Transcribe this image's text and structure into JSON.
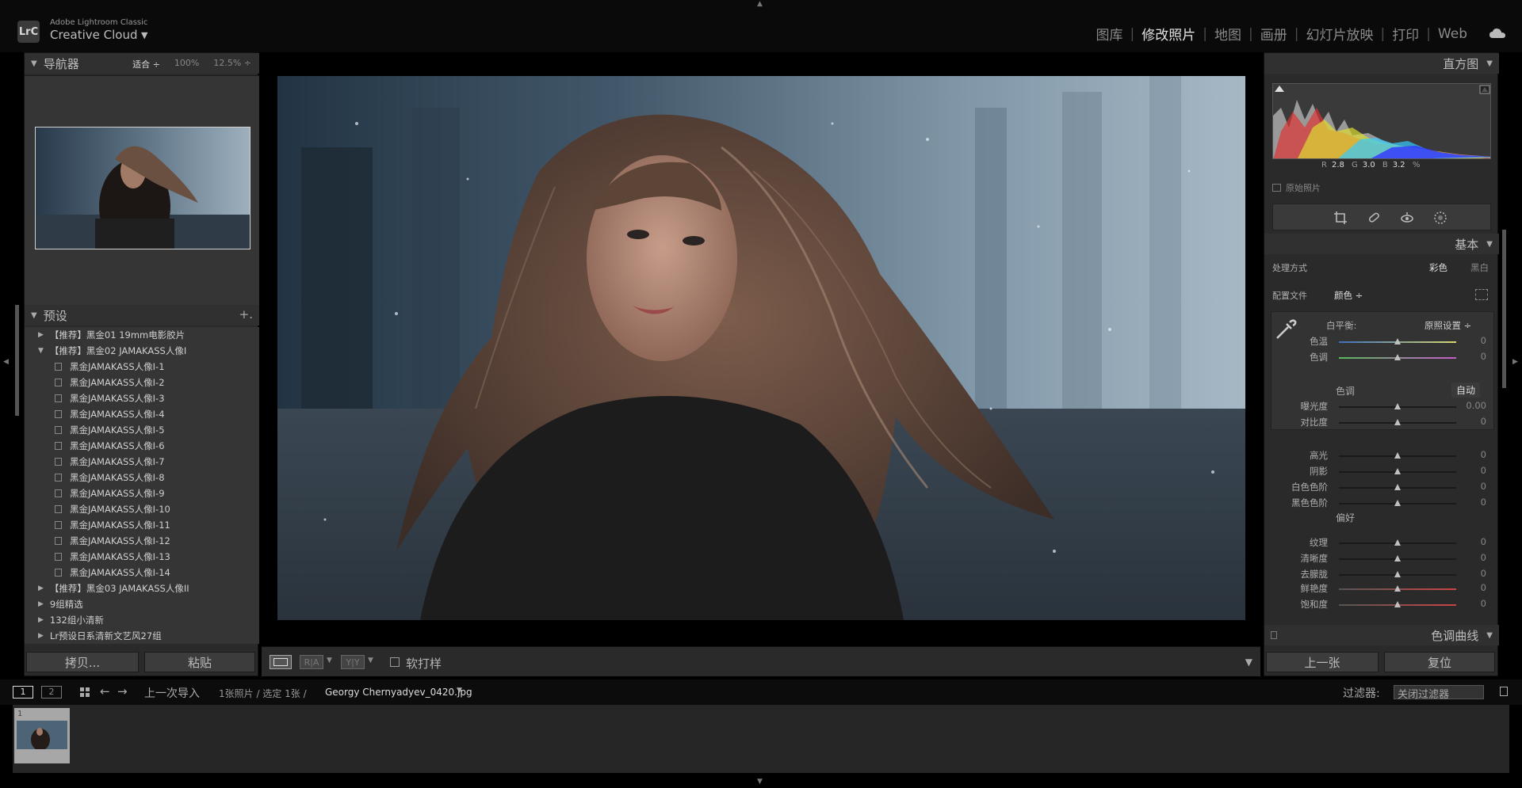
{
  "app": {
    "brand_small": "Adobe Lightroom Classic",
    "brand_big": "Creative Cloud",
    "logo": "LrC"
  },
  "modules": [
    {
      "label": "图库",
      "active": false
    },
    {
      "label": "修改照片",
      "active": true
    },
    {
      "label": "地图",
      "active": false
    },
    {
      "label": "画册",
      "active": false
    },
    {
      "label": "幻灯片放映",
      "active": false
    },
    {
      "label": "打印",
      "active": false
    },
    {
      "label": "Web",
      "active": false
    }
  ],
  "navigator": {
    "title": "导航器",
    "fit": "适合 ÷",
    "zoom1": "100%",
    "zoom2": "12.5% ÷"
  },
  "presets": {
    "title": "预设",
    "plus": "+.",
    "rows": [
      {
        "type": "folder",
        "open": false,
        "label": "【推荐】黑金01 19mm电影胶片"
      },
      {
        "type": "folder",
        "open": true,
        "label": "【推荐】黑金02 JAMAKASS人像I"
      },
      {
        "type": "item",
        "label": "黑金JAMAKASS人像I-1"
      },
      {
        "type": "item",
        "label": "黑金JAMAKASS人像I-2"
      },
      {
        "type": "item",
        "label": "黑金JAMAKASS人像I-3"
      },
      {
        "type": "item",
        "label": "黑金JAMAKASS人像I-4"
      },
      {
        "type": "item",
        "label": "黑金JAMAKASS人像I-5"
      },
      {
        "type": "item",
        "label": "黑金JAMAKASS人像I-6"
      },
      {
        "type": "item",
        "label": "黑金JAMAKASS人像I-7"
      },
      {
        "type": "item",
        "label": "黑金JAMAKASS人像I-8"
      },
      {
        "type": "item",
        "label": "黑金JAMAKASS人像I-9"
      },
      {
        "type": "item",
        "label": "黑金JAMAKASS人像I-10"
      },
      {
        "type": "item",
        "label": "黑金JAMAKASS人像I-11"
      },
      {
        "type": "item",
        "label": "黑金JAMAKASS人像I-12"
      },
      {
        "type": "item",
        "label": "黑金JAMAKASS人像I-13"
      },
      {
        "type": "item",
        "label": "黑金JAMAKASS人像I-14"
      },
      {
        "type": "folder",
        "open": false,
        "label": "【推荐】黑金03 JAMAKASS人像II"
      },
      {
        "type": "folder",
        "open": false,
        "label": "9组精选"
      },
      {
        "type": "folder",
        "open": false,
        "label": "132组小清新"
      },
      {
        "type": "folder",
        "open": false,
        "label": "Lr预设日系清新文艺风27组"
      }
    ]
  },
  "left_buttons": {
    "copy": "拷贝...",
    "paste": "粘贴"
  },
  "toolbar": {
    "softproof": "软打样",
    "ra": "R|A",
    "yy": "Y|Y"
  },
  "histogram": {
    "title": "直方图",
    "r_label": "R",
    "r_value": "2.8",
    "g_label": "G",
    "g_value": "3.0",
    "b_label": "B",
    "b_value": "3.2",
    "percent": "%",
    "original": "原始照片"
  },
  "basic": {
    "title": "基本",
    "treatment_label": "处理方式",
    "treatment_color": "彩色",
    "treatment_bw": "黑白",
    "profile_label": "配置文件",
    "profile_value": "颜色 ÷",
    "wb_label": "白平衡:",
    "wb_value": "原照设置 ÷",
    "tone_title": "色调",
    "auto": "自动",
    "presence_title": "偏好",
    "sliders": [
      {
        "label": "色温",
        "value": "0",
        "group": "wb"
      },
      {
        "label": "色调",
        "value": "0",
        "group": "wb"
      },
      {
        "label": "曝光度",
        "value": "0.00",
        "group": "tone"
      },
      {
        "label": "对比度",
        "value": "0",
        "group": "tone"
      },
      {
        "label": "高光",
        "value": "0",
        "group": "tone2"
      },
      {
        "label": "阴影",
        "value": "0",
        "group": "tone2"
      },
      {
        "label": "白色色阶",
        "value": "0",
        "group": "tone2"
      },
      {
        "label": "黑色色阶",
        "value": "0",
        "group": "tone2"
      },
      {
        "label": "纹理",
        "value": "0",
        "group": "pres"
      },
      {
        "label": "清晰度",
        "value": "0",
        "group": "pres"
      },
      {
        "label": "去朦胧",
        "value": "0",
        "group": "pres"
      },
      {
        "label": "鲜艳度",
        "value": "0",
        "group": "pres2"
      },
      {
        "label": "饱和度",
        "value": "0",
        "group": "pres2"
      }
    ]
  },
  "tone_curve": {
    "title": "色调曲线"
  },
  "right_buttons": {
    "prev": "上一张",
    "reset": "复位"
  },
  "statusbar": {
    "page1": "1",
    "page2": "2",
    "source": "上一次导入",
    "count": "1张照片 / 选定 1张 /",
    "filename": "Georgy Chernyadyev_0420.jpg",
    "filter_label": "过滤器:",
    "filter_value": "关闭过滤器"
  },
  "filmstrip": {
    "index": "1"
  }
}
